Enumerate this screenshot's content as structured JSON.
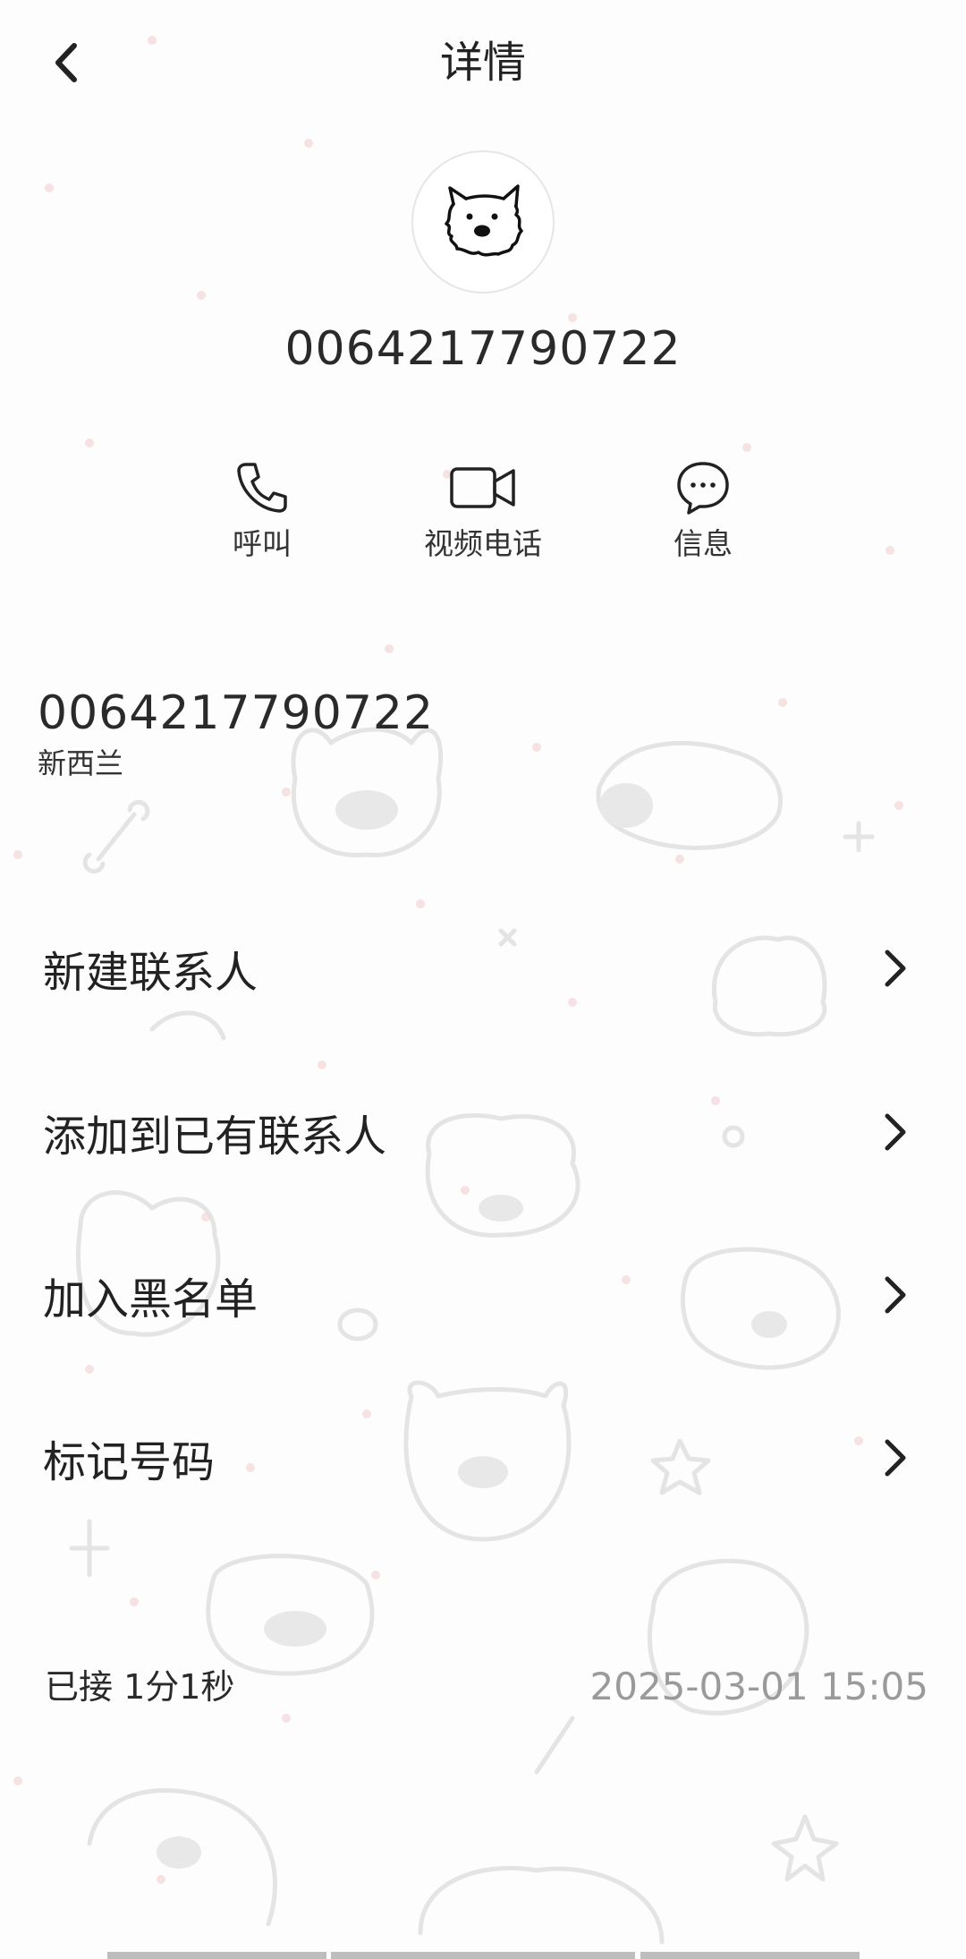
{
  "header": {
    "title": "详情",
    "back_icon": "chevron-left-icon"
  },
  "contact": {
    "avatar_icon": "dog-avatar-icon",
    "number": "0064217790722"
  },
  "actions": [
    {
      "label": "呼叫",
      "icon": "phone-icon"
    },
    {
      "label": "视频电话",
      "icon": "video-camera-icon"
    },
    {
      "label": "信息",
      "icon": "message-bubble-icon"
    }
  ],
  "number_block": {
    "number": "0064217790722",
    "location": "新西兰"
  },
  "menu": [
    {
      "label": "新建联系人"
    },
    {
      "label": "添加到已有联系人"
    },
    {
      "label": "加入黑名单"
    },
    {
      "label": "标记号码"
    }
  ],
  "call_log": {
    "status": "已接 1分1秒",
    "datetime": "2025-03-01 15:05"
  },
  "colors": {
    "text": "#222222",
    "secondary": "#9a9a9a",
    "doodle": "#e2e2e2"
  }
}
